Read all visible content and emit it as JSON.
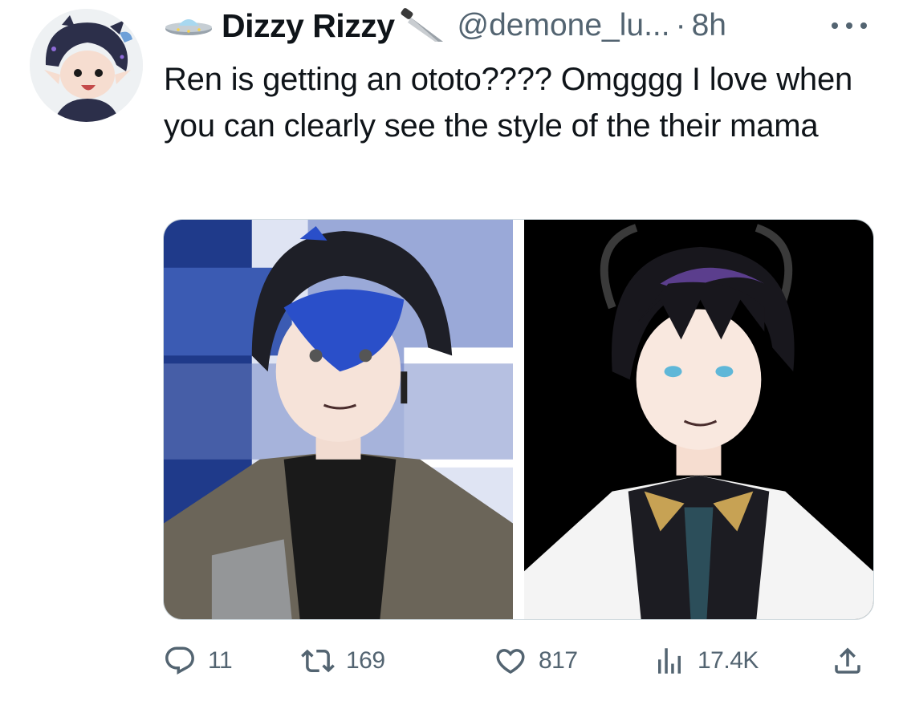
{
  "tweet": {
    "display_name": "Dizzy Rizzy",
    "handle": "@demone_lu...",
    "separator": "·",
    "timestamp": "8h",
    "text": "Ren is getting an ototo???? Omgggg I love when you can clearly see the style of the their mama",
    "name_icons": [
      "ufo-icon",
      "knife-icon"
    ]
  },
  "media": [
    {
      "name": "media-image-1",
      "background": "#1f3a8a"
    },
    {
      "name": "media-image-2",
      "background": "#000000"
    }
  ],
  "actions": {
    "reply": {
      "icon": "reply-icon",
      "count": "11"
    },
    "retweet": {
      "icon": "retweet-icon",
      "count": "169"
    },
    "like": {
      "icon": "heart-icon",
      "count": "817"
    },
    "views": {
      "icon": "views-icon",
      "count": "17.4K"
    },
    "share": {
      "icon": "share-icon"
    }
  },
  "colors": {
    "text_primary": "#0f1419",
    "text_secondary": "#536471",
    "border": "#cfd9de"
  }
}
